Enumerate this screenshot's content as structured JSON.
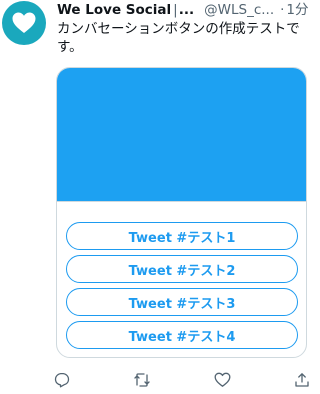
{
  "account": {
    "name": "We Love Social",
    "separator": "|",
    "ellipsis": "...",
    "handle": "@WLS_c...",
    "dot": "·",
    "time": "1分"
  },
  "tweet": {
    "text": "カンバセーションボタンの作成テストです。"
  },
  "card": {
    "image_color": "#1da1f2",
    "buttons": [
      {
        "label": "Tweet #テスト1"
      },
      {
        "label": "Tweet #テスト2"
      },
      {
        "label": "Tweet #テスト3"
      },
      {
        "label": "Tweet #テスト4"
      }
    ]
  },
  "actions": {
    "reply_icon": "reply-icon",
    "retweet_icon": "retweet-icon",
    "like_icon": "heart-icon",
    "share_icon": "share-icon"
  },
  "colors": {
    "accent": "#1d9bf0",
    "avatar": "#1aa8bd",
    "muted": "#536471"
  }
}
